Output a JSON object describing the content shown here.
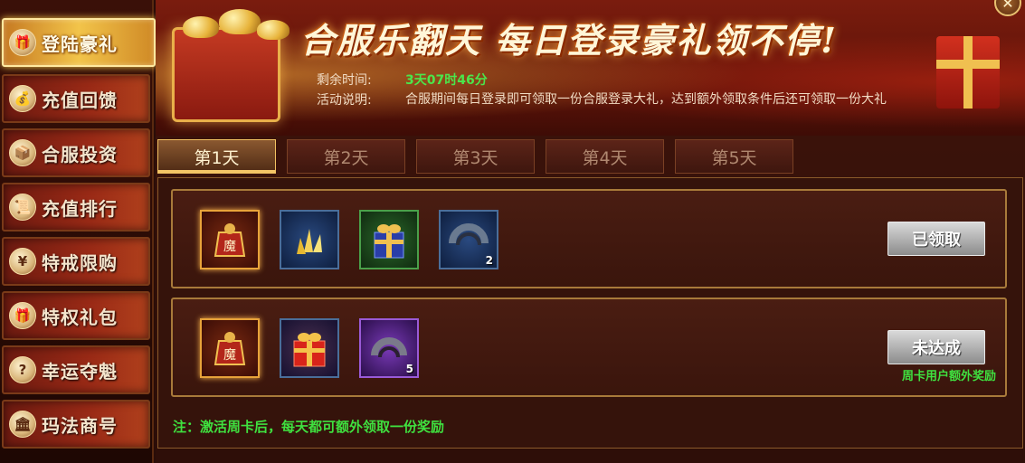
{
  "sidebar": {
    "items": [
      {
        "label": "登陆豪礼",
        "icon": "gift-icon",
        "glyph": "🎁"
      },
      {
        "label": "充值回馈",
        "icon": "money-bag-icon",
        "glyph": "💰"
      },
      {
        "label": "合服投资",
        "icon": "treasure-chest-icon",
        "glyph": "📦"
      },
      {
        "label": "充值排行",
        "icon": "scroll-icon",
        "glyph": "📜"
      },
      {
        "label": "特戒限购",
        "icon": "yuan-coin-icon",
        "glyph": "¥"
      },
      {
        "label": "特权礼包",
        "icon": "gift-box-icon",
        "glyph": "🎁"
      },
      {
        "label": "幸运夺魁",
        "icon": "question-mark-icon",
        "glyph": "?"
      },
      {
        "label": "玛法商号",
        "icon": "shop-icon",
        "glyph": "🏛"
      }
    ],
    "active_index": 0
  },
  "banner": {
    "headline": "合服乐翻天  每日登录豪礼领不停!",
    "remaining_label": "剩余时间:",
    "remaining_value": "3天07时46分",
    "desc_label": "活动说明:",
    "desc_text": "合服期间每日登录即可领取一份合服登录大礼，达到额外领取条件后还可领取一份大礼"
  },
  "tabs": [
    {
      "label": "第1天"
    },
    {
      "label": "第2天"
    },
    {
      "label": "第3天"
    },
    {
      "label": "第4天"
    },
    {
      "label": "第5天"
    }
  ],
  "active_tab": 0,
  "rewards": [
    {
      "items": [
        {
          "icon": "demon-bag-icon",
          "frame": "gold",
          "count": ""
        },
        {
          "icon": "gold-crystal-icon",
          "frame": "blue",
          "count": ""
        },
        {
          "icon": "blue-gift-box-icon",
          "frame": "green",
          "count": ""
        },
        {
          "icon": "ring-fragment-icon",
          "frame": "blue",
          "count": "2"
        }
      ],
      "button_label": "已领取",
      "extra_label": ""
    },
    {
      "items": [
        {
          "icon": "demon-bag-icon",
          "frame": "gold",
          "count": ""
        },
        {
          "icon": "red-gift-box-icon",
          "frame": "blue",
          "count": ""
        },
        {
          "icon": "purple-ring-fragment-icon",
          "frame": "purple",
          "count": "5"
        }
      ],
      "button_label": "未达成",
      "extra_label": "周卡用户额外奖励"
    }
  ],
  "note": "注：激活周卡后，每天都可额外领取一份奖励",
  "colors": {
    "accent_gold": "#f2c44a",
    "countdown_green": "#4be64b",
    "note_green": "#3fe03f"
  }
}
